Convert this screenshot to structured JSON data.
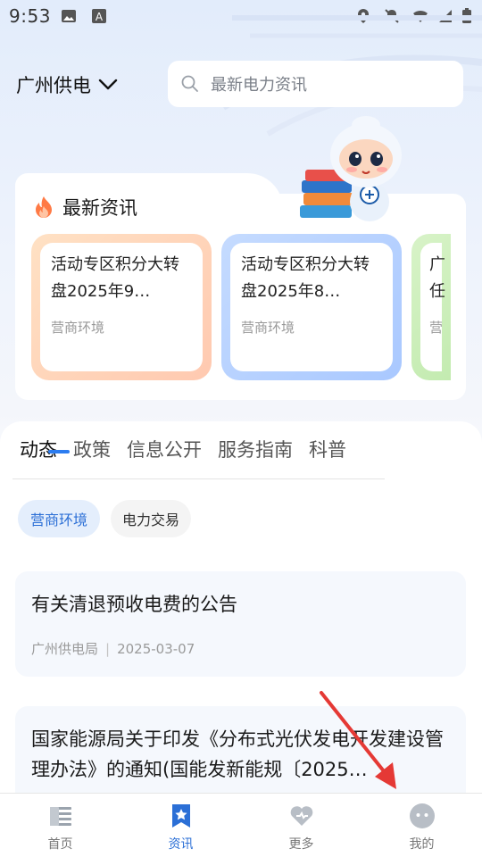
{
  "status_bar": {
    "time": "9:53"
  },
  "header": {
    "city": "广州供电",
    "search_placeholder": "最新电力资讯"
  },
  "news": {
    "title": "最新资讯",
    "items": [
      {
        "title": "活动专区积分大转盘2025年9…",
        "tag": "营商环境"
      },
      {
        "title": "活动专区积分大转盘2025年8…",
        "tag": "营商环境"
      },
      {
        "title": "广任",
        "tag": "营"
      }
    ]
  },
  "tabs": [
    "动态",
    "政策",
    "信息公开",
    "服务指南",
    "科普"
  ],
  "chips": [
    "营商环境",
    "电力交易"
  ],
  "articles": [
    {
      "title": "有关清退预收电费的公告",
      "source": "广州供电局",
      "date": "2025-03-07"
    },
    {
      "title": "国家能源局关于印发《分布式光伏发电开发建设管理办法》的通知(国能发新能规〔2025…",
      "source": "",
      "date": ""
    }
  ],
  "bottom_nav": [
    {
      "label": "首页",
      "icon": "home-icon"
    },
    {
      "label": "资讯",
      "icon": "news-bookmark-icon"
    },
    {
      "label": "更多",
      "icon": "more-heart-icon"
    },
    {
      "label": "我的",
      "icon": "profile-face-icon"
    }
  ],
  "colors": {
    "accent": "#2b6fd6",
    "annotation_arrow": "#e53935"
  }
}
